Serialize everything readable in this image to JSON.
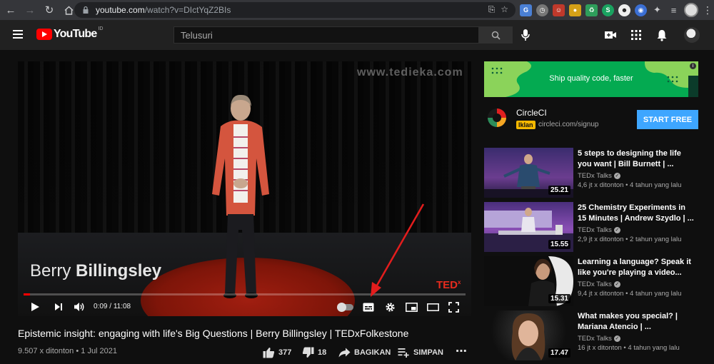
{
  "browser": {
    "url_host": "youtube.com",
    "url_path": "/watch?v=DIctYqZ2BIs"
  },
  "header": {
    "logo_text": "YouTube",
    "region": "ID",
    "search_placeholder": "Telusuri"
  },
  "player": {
    "watermark": "www.tedieka.com",
    "speaker_first": "Berry",
    "speaker_last": "Billingsley",
    "brand": "TED",
    "brand_sup": "x",
    "time_current": "0:09",
    "time_total": "11:08",
    "progress_fraction": 0.014
  },
  "video": {
    "title": "Epistemic insight: engaging with life's Big Questions | Berry Billingsley | TEDxFolkestone",
    "views": "9.507 x ditonton",
    "date": "1 Jul 2021",
    "likes": "377",
    "dislikes": "18",
    "share_label": "BAGIKAN",
    "save_label": "SIMPAN"
  },
  "ad": {
    "banner_text": "Ship quality code, faster",
    "name": "CircleCI",
    "badge": "Iklan",
    "url": "circleci.com/signup",
    "cta": "START FREE"
  },
  "recommendations": [
    {
      "title": "5 steps to designing the life you want | Bill Burnett | ...",
      "channel": "TEDx Talks",
      "views": "4,6 jt x ditonton",
      "age": "4 tahun yang lalu",
      "duration": "25.21"
    },
    {
      "title": "25 Chemistry Experiments in 15 Minutes | Andrew Szydlo | ...",
      "channel": "TEDx Talks",
      "views": "2,9 jt x ditonton",
      "age": "2 tahun yang lalu",
      "duration": "15.55"
    },
    {
      "title": "Learning a language? Speak it like you're playing a video...",
      "channel": "TEDx Talks",
      "views": "9,4 jt x ditonton",
      "age": "4 tahun yang lalu",
      "duration": "15.31"
    },
    {
      "title": "What makes you special? | Mariana Atencio | ...",
      "channel": "TEDx Talks",
      "views": "16 jt x ditonton",
      "age": "4 tahun yang lalu",
      "duration": "17.47"
    }
  ],
  "colors": {
    "youtube_red": "#ff0000",
    "ad_green": "#04aa51",
    "cta_blue": "#3ea6ff",
    "ted_red": "#e62b1e"
  }
}
